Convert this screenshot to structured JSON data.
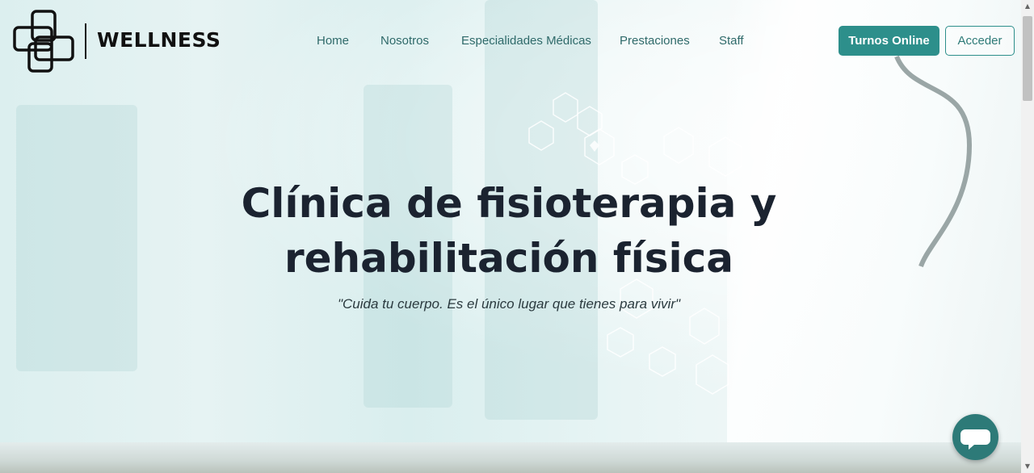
{
  "brand": {
    "name": "WELLNESS",
    "logo_icon": "cross-outline-logo"
  },
  "nav": {
    "links": [
      {
        "label": "Home"
      },
      {
        "label": "Nosotros"
      },
      {
        "label": "Especialidades Médicas"
      },
      {
        "label": "Prestaciones"
      },
      {
        "label": "Staff"
      }
    ],
    "turnos_label": "Turnos Online",
    "acceder_label": "Acceder"
  },
  "hero": {
    "title_line1": "Clínica de fisioterapia y",
    "title_line2": "rehabilitación física",
    "tagline": "\"Cuida tu cuerpo. Es el único lugar que tienes para vivir\""
  },
  "chat": {
    "icon": "chat-bubble-icon"
  },
  "colors": {
    "accent": "#2d8f8b",
    "text_dark": "#1b2330",
    "nav_text": "#2f6a6a"
  }
}
